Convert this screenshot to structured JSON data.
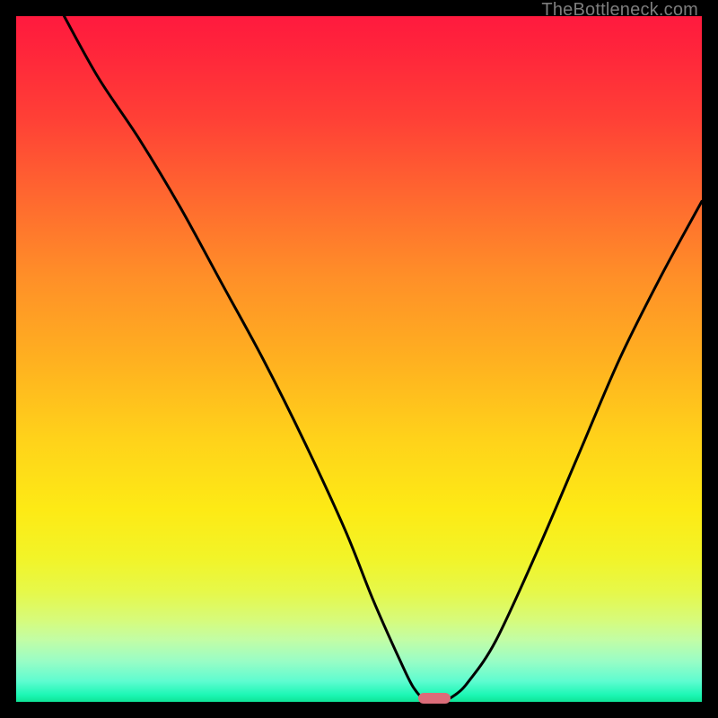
{
  "watermark": "TheBottleneck.com",
  "colors": {
    "frame": "#000000",
    "curve": "#000000",
    "marker": "#dc6c79"
  },
  "chart_data": {
    "type": "line",
    "title": "",
    "xlabel": "",
    "ylabel": "",
    "xlim": [
      0,
      100
    ],
    "ylim": [
      0,
      100
    ],
    "grid": false,
    "series": [
      {
        "name": "bottleneck-curve",
        "x": [
          7,
          12,
          18,
          24,
          30,
          36,
          42,
          48,
          52,
          56,
          58,
          60,
          62,
          64,
          66,
          70,
          76,
          82,
          88,
          94,
          100
        ],
        "y": [
          100,
          91,
          82,
          72,
          61,
          50,
          38,
          25,
          15,
          6,
          2,
          0,
          0,
          1,
          3,
          9,
          22,
          36,
          50,
          62,
          73
        ]
      }
    ],
    "annotations": [
      {
        "name": "optimal-marker",
        "x": 61,
        "y": 0.5,
        "shape": "pill"
      }
    ],
    "gradient_stops": [
      {
        "pos": 0.0,
        "color": "#ff1a3e"
      },
      {
        "pos": 0.5,
        "color": "#ffb020"
      },
      {
        "pos": 0.8,
        "color": "#f2f428"
      },
      {
        "pos": 1.0,
        "color": "#0fe396"
      }
    ]
  }
}
